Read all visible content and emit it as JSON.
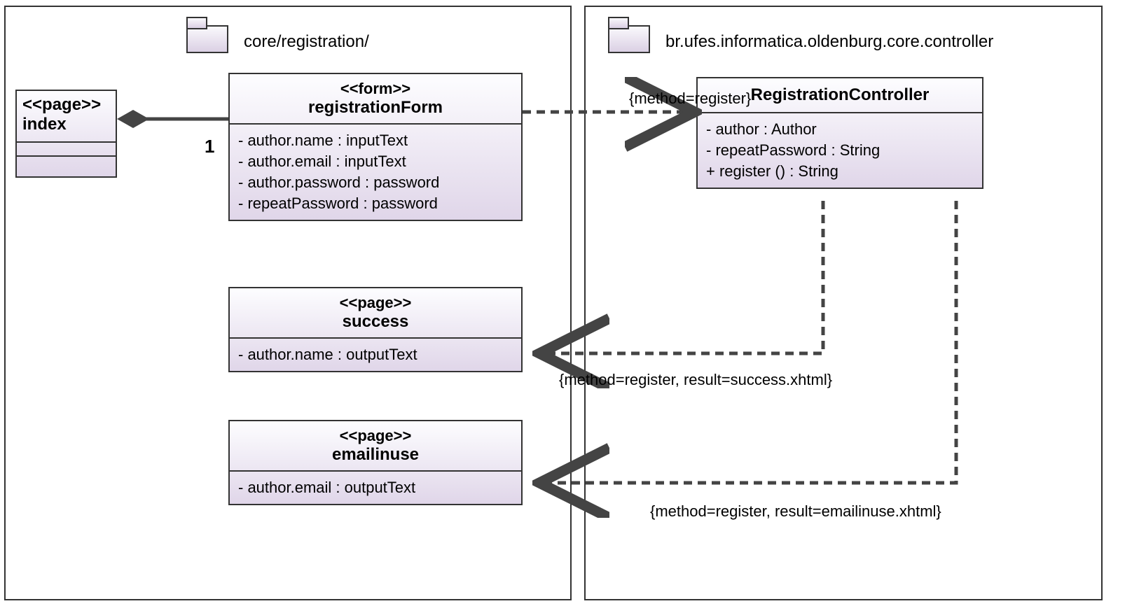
{
  "package_left": {
    "name": "core/registration/"
  },
  "package_right": {
    "name": "br.ufes.informatica.oldenburg.core.controller"
  },
  "index": {
    "stereotype": "<<page>>",
    "name": "index"
  },
  "registrationForm": {
    "stereotype": "<<form>>",
    "name": "registrationForm",
    "attributes": [
      "- author.name : inputText",
      "- author.email : inputText",
      "- author.password : password",
      "- repeatPassword : password"
    ]
  },
  "success": {
    "stereotype": "<<page>>",
    "name": "success",
    "attributes": [
      "- author.name : outputText"
    ]
  },
  "emailinuse": {
    "stereotype": "<<page>>",
    "name": "emailinuse",
    "attributes": [
      "- author.email : outputText"
    ]
  },
  "controller": {
    "name": "RegistrationController",
    "attributes": [
      "- author : Author",
      "- repeatPassword : String",
      "+ register () : String"
    ]
  },
  "assoc": {
    "multiplicity": "1",
    "label1": "{method=register}",
    "label2": "{method=register, result=success.xhtml}",
    "label3": "{method=register, result=emailinuse.xhtml}"
  }
}
